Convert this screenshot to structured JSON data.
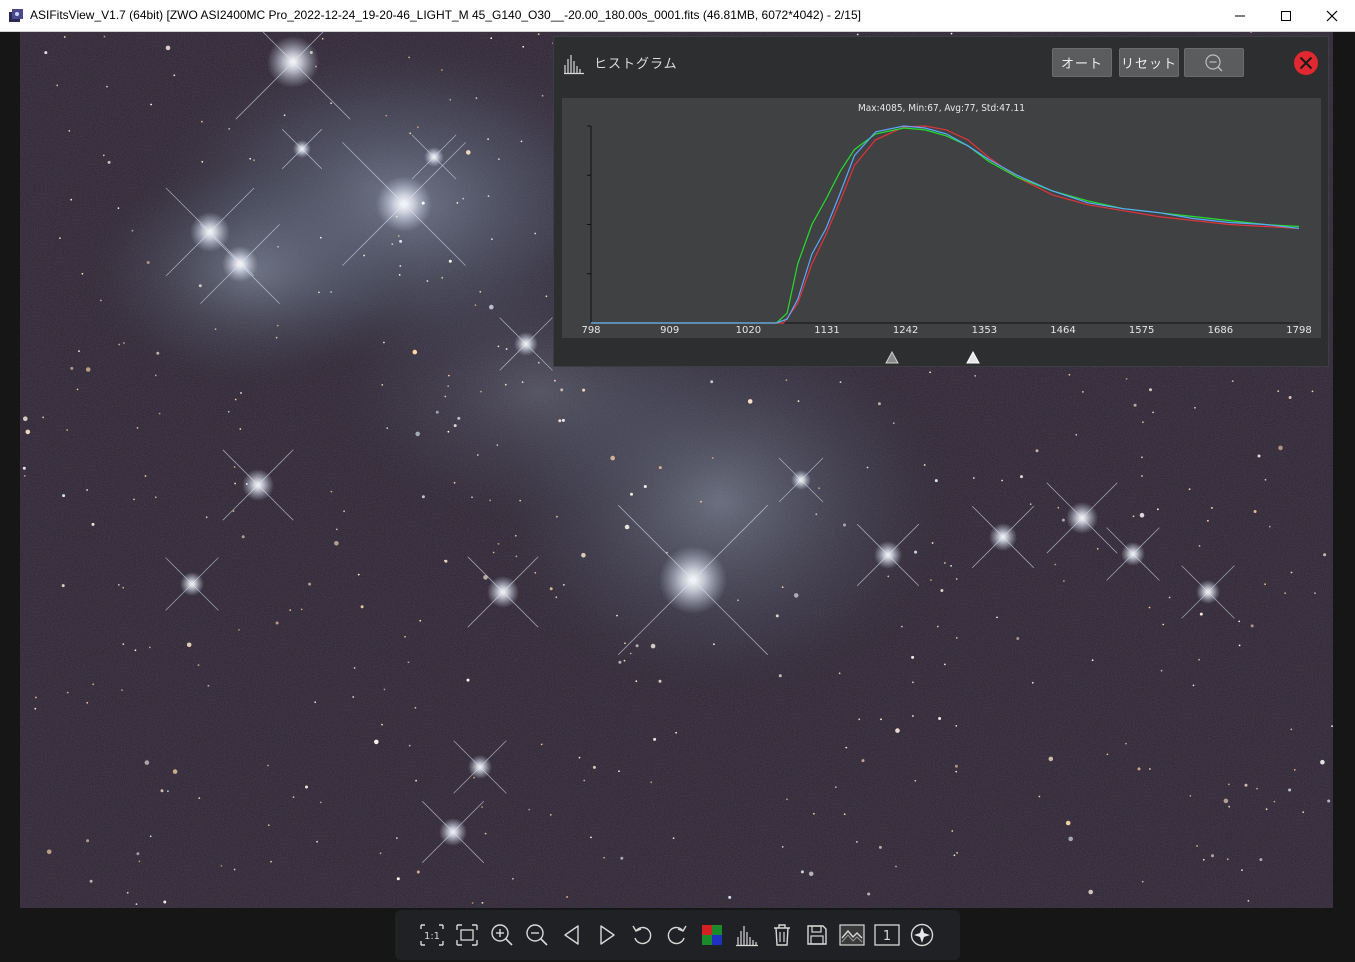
{
  "window": {
    "title": "ASIFitsView_V1.7 (64bit) [ZWO ASI2400MC Pro_2022-12-24_19-20-46_LIGHT_M 45_G140_O30__-20.00_180.00s_0001.fits (46.81MB, 6072*4042) - 2/15]",
    "minimize_icon": "minimize-icon",
    "maximize_icon": "maximize-icon",
    "close_icon": "close-icon"
  },
  "histogram": {
    "title": "ヒストグラム",
    "auto_label": "オート",
    "reset_label": "リセット",
    "zoom_icon": "zoom-out-icon",
    "close_icon": "close-circle-icon",
    "stats": "Max:4085, Min:67, Avg:77, Std:47.11",
    "colors": {
      "red": "#e0343a",
      "green": "#22e02c",
      "blue": "#5aa8ff",
      "accent_close": "#e02830"
    }
  },
  "chart_data": {
    "type": "line",
    "x_ticks": [
      "798",
      "909",
      "1020",
      "1131",
      "1242",
      "1353",
      "1464",
      "1575",
      "1686",
      "1798"
    ],
    "xlim": [
      798,
      1798
    ],
    "ylim": [
      0,
      1
    ],
    "series": [
      {
        "color": "#e0343a",
        "x": [
          798,
          1050,
          1070,
          1090,
          1110,
          1130,
          1150,
          1170,
          1200,
          1240,
          1270,
          1300,
          1330,
          1360,
          1400,
          1450,
          1500,
          1550,
          1600,
          1650,
          1700,
          1750,
          1798
        ],
        "y": [
          0,
          0,
          0.0,
          0.1,
          0.3,
          0.45,
          0.62,
          0.8,
          0.93,
          0.995,
          1.0,
          0.98,
          0.93,
          0.84,
          0.74,
          0.65,
          0.6,
          0.57,
          0.54,
          0.52,
          0.5,
          0.49,
          0.48
        ]
      },
      {
        "color": "#22e02c",
        "x": [
          798,
          1060,
          1075,
          1090,
          1110,
          1130,
          1150,
          1170,
          1200,
          1240,
          1270,
          1300,
          1330,
          1360,
          1400,
          1450,
          1500,
          1550,
          1600,
          1650,
          1700,
          1750,
          1798
        ],
        "y": [
          0,
          0,
          0.05,
          0.3,
          0.5,
          0.63,
          0.77,
          0.88,
          0.96,
          0.99,
          0.98,
          0.95,
          0.9,
          0.82,
          0.74,
          0.67,
          0.62,
          0.58,
          0.56,
          0.54,
          0.52,
          0.5,
          0.49
        ]
      },
      {
        "color": "#5aa8ff",
        "x": [
          798,
          1060,
          1075,
          1090,
          1110,
          1130,
          1150,
          1170,
          1200,
          1240,
          1270,
          1300,
          1330,
          1360,
          1400,
          1450,
          1500,
          1550,
          1600,
          1650,
          1700,
          1750,
          1798
        ],
        "y": [
          0,
          0,
          0.02,
          0.12,
          0.35,
          0.48,
          0.66,
          0.85,
          0.97,
          1.0,
          0.99,
          0.96,
          0.9,
          0.83,
          0.75,
          0.67,
          0.61,
          0.58,
          0.56,
          0.53,
          0.51,
          0.5,
          0.48
        ]
      }
    ],
    "slider_low": 1223,
    "slider_high": 1337
  },
  "toolbar": {
    "icons": [
      "actual-size-icon",
      "fit-window-icon",
      "zoom-in-icon",
      "zoom-out-icon",
      "previous-icon",
      "next-icon",
      "rotate-left-icon",
      "rotate-right-icon",
      "color-channels-icon",
      "histogram-icon",
      "delete-icon",
      "save-icon",
      "stretch-icon",
      "single-view-icon",
      "star-detect-icon"
    ],
    "actual_size_label": "1:1",
    "single_view_label": "1"
  }
}
